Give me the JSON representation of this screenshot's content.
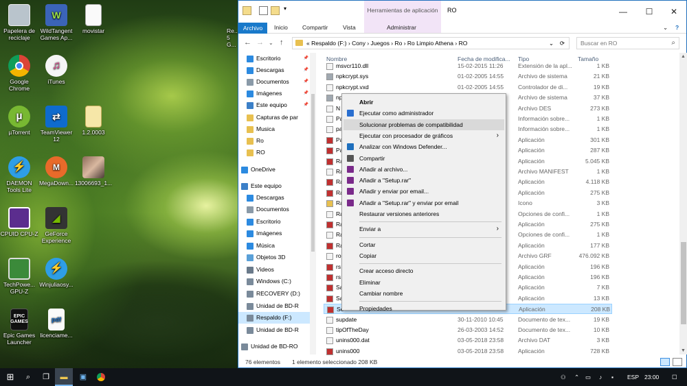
{
  "desktop": {
    "icons": [
      {
        "label": "Papelera de reciclaje",
        "icon": "recycle-bin-icon"
      },
      {
        "label": "WildTangent Games Ap...",
        "icon": "wildtangent-icon",
        "badge": "Games"
      },
      {
        "label": "movistar",
        "icon": "text-file-icon"
      },
      {
        "label": "Google Chrome",
        "icon": "chrome-icon"
      },
      {
        "label": "iTunes",
        "icon": "itunes-icon"
      },
      {
        "label": "µTorrent",
        "icon": "utorrent-icon"
      },
      {
        "label": "TeamViewer 12",
        "icon": "teamviewer-icon"
      },
      {
        "label": "1.2.0003",
        "icon": "file-icon"
      },
      {
        "label": "DAEMON Tools Lite",
        "icon": "daemon-tools-icon"
      },
      {
        "label": "MegaDown...",
        "icon": "mega-icon"
      },
      {
        "label": "13006693_1...",
        "icon": "photo-icon"
      },
      {
        "label": "CPUID CPU-Z",
        "icon": "cpuz-icon"
      },
      {
        "label": "GeForce Experience",
        "icon": "geforce-icon"
      },
      {
        "label": "TechPowe... GPU-Z",
        "icon": "gpuz-icon"
      },
      {
        "label": "Winjuliaosy...",
        "icon": "winjulia-icon"
      },
      {
        "label": "Epic Games Launcher",
        "icon": "epic-games-icon",
        "badge": "EPIC GAMES"
      },
      {
        "label": "licenciame...",
        "icon": "pdf-icon",
        "badge": "pdf"
      }
    ],
    "partial_label": "Re... 5 G..."
  },
  "explorer": {
    "title": "RO",
    "contextual_tab": "Herramientas de aplicación",
    "ribbon_tabs": [
      "Archivo",
      "Inicio",
      "Compartir",
      "Vista",
      "Administrar"
    ],
    "breadcrumb": "«  Respaldo (F:)  ›  Cony  ›  Juegos  ›  Ro  ›  Ro Limpio Athena  ›  RO",
    "search_placeholder": "Buscar en RO",
    "nav": [
      {
        "label": "Escritorio",
        "pinned": true
      },
      {
        "label": "Descargas",
        "pinned": true
      },
      {
        "label": "Documentos",
        "pinned": true
      },
      {
        "label": "Imágenes",
        "pinned": true
      },
      {
        "label": "Este equipo",
        "pinned": true
      },
      {
        "label": "Capturas de par"
      },
      {
        "label": "Musica"
      },
      {
        "label": "Ro"
      },
      {
        "label": "RO"
      },
      {
        "label": "OneDrive"
      },
      {
        "label": "Este equipo"
      },
      {
        "label": "Descargas"
      },
      {
        "label": "Documentos"
      },
      {
        "label": "Escritorio"
      },
      {
        "label": "Imágenes"
      },
      {
        "label": "Música"
      },
      {
        "label": "Objetos 3D"
      },
      {
        "label": "Videos"
      },
      {
        "label": "Windows (C:)"
      },
      {
        "label": "RECOVERY (D:)"
      },
      {
        "label": "Unidad de BD-R"
      },
      {
        "label": "Respaldo (F:)",
        "selected": true
      },
      {
        "label": "Unidad de BD-R"
      },
      {
        "label": "Unidad de BD-RO"
      }
    ],
    "columns": {
      "name": "Nombre",
      "date": "Fecha de modifica...",
      "type": "Tipo",
      "size": "Tamaño"
    },
    "files": [
      {
        "name": "msvcr110.dll",
        "date": "15-02-2015 11:26",
        "type": "Extensión de la apl...",
        "size": "1 KB"
      },
      {
        "name": "npkcrypt.sys",
        "date": "01-02-2005 14:55",
        "type": "Archivo de sistema",
        "size": "21 KB"
      },
      {
        "name": "npkcrypt.vxd",
        "date": "01-02-2005 14:55",
        "type": "Controlador de di...",
        "size": "19 KB"
      },
      {
        "name": "np",
        "date": "",
        "type": "Archivo de sistema",
        "size": "37 KB"
      },
      {
        "name": "N",
        "date": "",
        "type": "Archivo DES",
        "size": "273 KB"
      },
      {
        "name": "Pa",
        "date": "",
        "type": "Información sobre...",
        "size": "1 KB"
      },
      {
        "name": "pa",
        "date": "",
        "type": "Información sobre...",
        "size": "1 KB"
      },
      {
        "name": "Pa",
        "date": "",
        "type": "Aplicación",
        "size": "301 KB"
      },
      {
        "name": "Pa",
        "date": "",
        "type": "Aplicación",
        "size": "287 KB"
      },
      {
        "name": "Ra",
        "date": "",
        "type": "Aplicación",
        "size": "5.045 KB"
      },
      {
        "name": "Ra",
        "date": "",
        "type": "Archivo MANIFEST",
        "size": "1 KB"
      },
      {
        "name": "Ra",
        "date": "",
        "type": "Aplicación",
        "size": "4.118 KB"
      },
      {
        "name": "Ra",
        "date": "",
        "type": "Aplicación",
        "size": "275 KB"
      },
      {
        "name": "Ra",
        "date": "",
        "type": "Icono",
        "size": "3 KB"
      },
      {
        "name": "Ra",
        "date": "",
        "type": "Opciones de confi...",
        "size": "1 KB"
      },
      {
        "name": "Ra",
        "date": "",
        "type": "Aplicación",
        "size": "275 KB"
      },
      {
        "name": "Ra",
        "date": "",
        "type": "Opciones de confi...",
        "size": "1 KB"
      },
      {
        "name": "Ra",
        "date": "",
        "type": "Aplicación",
        "size": "177 KB"
      },
      {
        "name": "ro",
        "date": "",
        "type": "Archivo GRF",
        "size": "476.092 KB"
      },
      {
        "name": "rs",
        "date": "",
        "type": "Aplicación",
        "size": "196 KB"
      },
      {
        "name": "rs",
        "date": "",
        "type": "Aplicación",
        "size": "196 KB"
      },
      {
        "name": "Sa",
        "date": "",
        "type": "Aplicación",
        "size": "7 KB"
      },
      {
        "name": "Sa",
        "date": "",
        "type": "Aplicación",
        "size": "13 KB"
      },
      {
        "name": "Se",
        "date": "",
        "type": "Aplicación",
        "size": "208 KB",
        "selected": true
      },
      {
        "name": "supdate",
        "date": "30-11-2010 10:45",
        "type": "Documento de tex...",
        "size": "19 KB"
      },
      {
        "name": "tipOfTheDay",
        "date": "26-03-2003 14:52",
        "type": "Documento de tex...",
        "size": "10 KB"
      },
      {
        "name": "unins000.dat",
        "date": "03-05-2018 23:58",
        "type": "Archivo DAT",
        "size": "3 KB"
      },
      {
        "name": "unins000",
        "date": "03-05-2018 23:58",
        "type": "Aplicación",
        "size": "728 KB"
      }
    ],
    "status": {
      "count": "76 elementos",
      "selection": "1 elemento seleccionado  208 KB"
    }
  },
  "context_menu": [
    {
      "label": "Abrir",
      "bold": true
    },
    {
      "label": "Ejecutar como administrador",
      "icon": "shield-icon"
    },
    {
      "label": "Solucionar problemas de compatibilidad",
      "hover": true
    },
    {
      "label": "Ejecutar con procesador de gráficos",
      "submenu": true
    },
    {
      "label": "Analizar con Windows Defender...",
      "icon": "defender-icon"
    },
    {
      "label": "Compartir",
      "icon": "share-icon"
    },
    {
      "label": "Añadir al archivo...",
      "icon": "winrar-icon"
    },
    {
      "label": "Añadir a \"Setup.rar\"",
      "icon": "winrar-icon"
    },
    {
      "label": "Añadir y enviar por email...",
      "icon": "winrar-icon"
    },
    {
      "label": "Añadir a \"Setup.rar\" y enviar por email",
      "icon": "winrar-icon"
    },
    {
      "label": "Restaurar versiones anteriores"
    },
    {
      "separator": true
    },
    {
      "label": "Enviar a",
      "submenu": true
    },
    {
      "separator": true
    },
    {
      "label": "Cortar"
    },
    {
      "label": "Copiar"
    },
    {
      "separator": true
    },
    {
      "label": "Crear acceso directo"
    },
    {
      "label": "Eliminar"
    },
    {
      "label": "Cambiar nombre"
    },
    {
      "separator": true
    },
    {
      "label": "Propiedades"
    }
  ],
  "taskbar": {
    "lang": "ESP",
    "time": "23:00"
  }
}
